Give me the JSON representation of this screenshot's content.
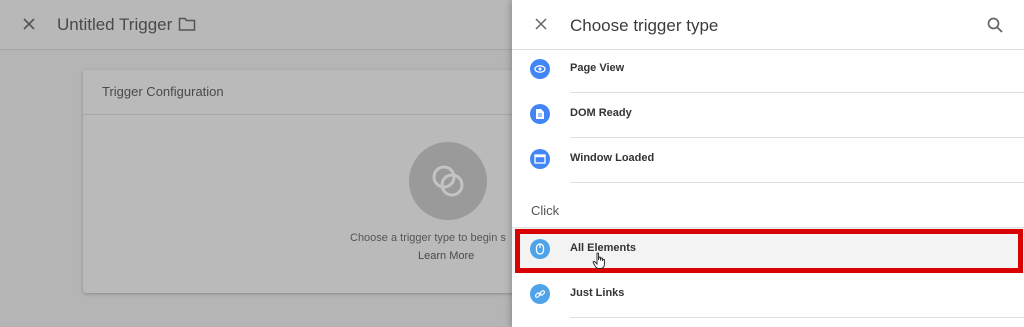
{
  "editor": {
    "title": "Untitled Trigger",
    "config_title": "Trigger Configuration",
    "hint": "Choose a trigger type to begin s",
    "learn_more": "Learn More"
  },
  "panel": {
    "title": "Choose trigger type",
    "items_top": [
      {
        "label": "Page View",
        "icon": "eye-icon"
      },
      {
        "label": "DOM Ready",
        "icon": "document-icon"
      },
      {
        "label": "Window Loaded",
        "icon": "window-icon"
      }
    ],
    "section_label": "Click",
    "items_click": [
      {
        "label": "All Elements",
        "icon": "mouse-icon"
      },
      {
        "label": "Just Links",
        "icon": "link-icon"
      }
    ]
  },
  "colors": {
    "accent_blue": "#4285f4",
    "light_blue": "#4fa3e8",
    "highlight_red": "#d80000"
  }
}
